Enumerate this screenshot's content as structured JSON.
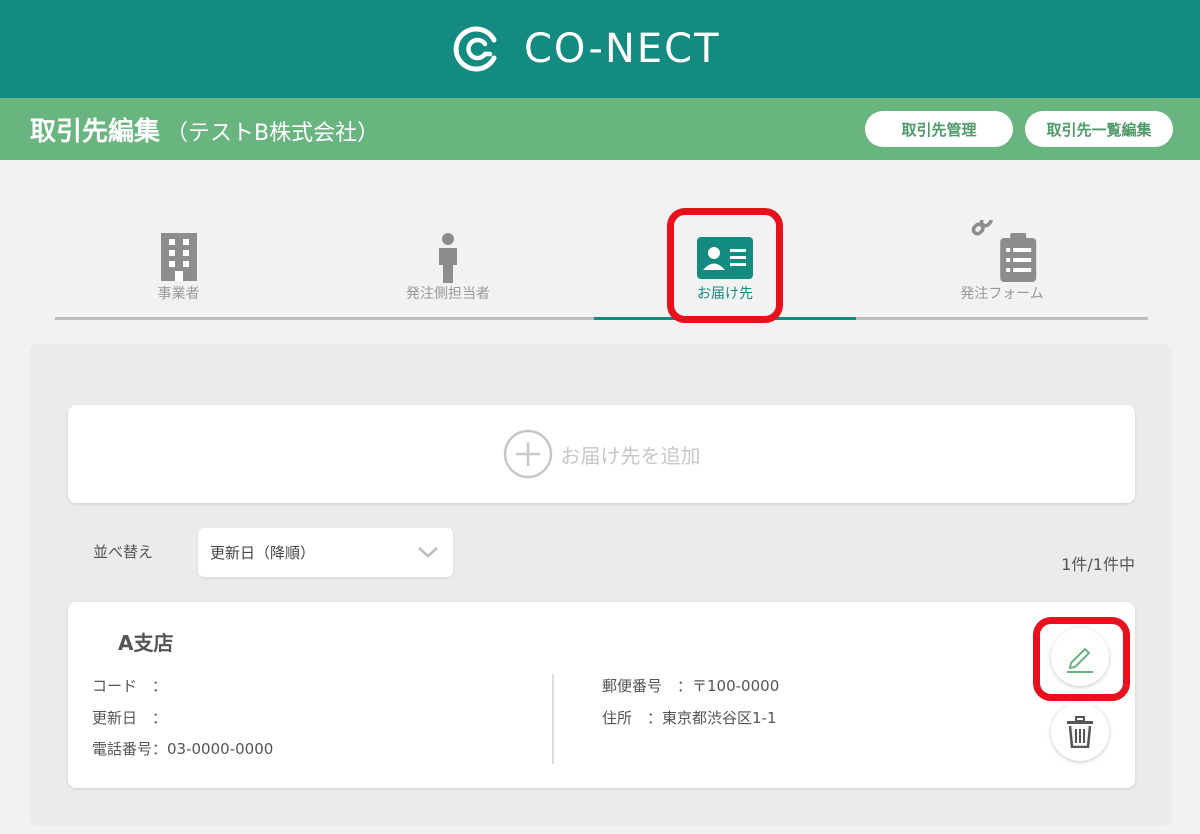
{
  "header": {
    "logo_text": "CO-NECT",
    "brand_color": "#148b80"
  },
  "subheader": {
    "title": "取引先編集",
    "subtitle": "（テストB株式会社）",
    "buttons": [
      {
        "label": "取引先管理"
      },
      {
        "label": "取引先一覧編集"
      }
    ],
    "bar_color": "#69b57f"
  },
  "tabs": [
    {
      "label": "事業者",
      "icon": "building-icon"
    },
    {
      "label": "発注側担当者",
      "icon": "person-icon"
    },
    {
      "label": "お届け先",
      "icon": "contact-card-icon",
      "active": true
    },
    {
      "label": "発注フォーム",
      "icon": "clipboard-link-icon"
    }
  ],
  "add_destination": {
    "label": "お届け先を追加",
    "icon": "plus-circle-icon"
  },
  "sort": {
    "label": "並べ替え",
    "value": "更新日（降順）"
  },
  "result_count": "1件/1件中",
  "destinations": [
    {
      "name": "A支店",
      "code_label": "コード　：",
      "code_value": "",
      "updated_label": "更新日　：",
      "updated_value": "",
      "phone_label": "電話番号：",
      "phone_value": "03-0000-0000",
      "postal_label": "郵便番号　：",
      "postal_value": "〒100-0000",
      "address_label": "住所　：",
      "address_value": "東京都渋谷区1-1"
    }
  ],
  "highlight_color": "#e8101c"
}
